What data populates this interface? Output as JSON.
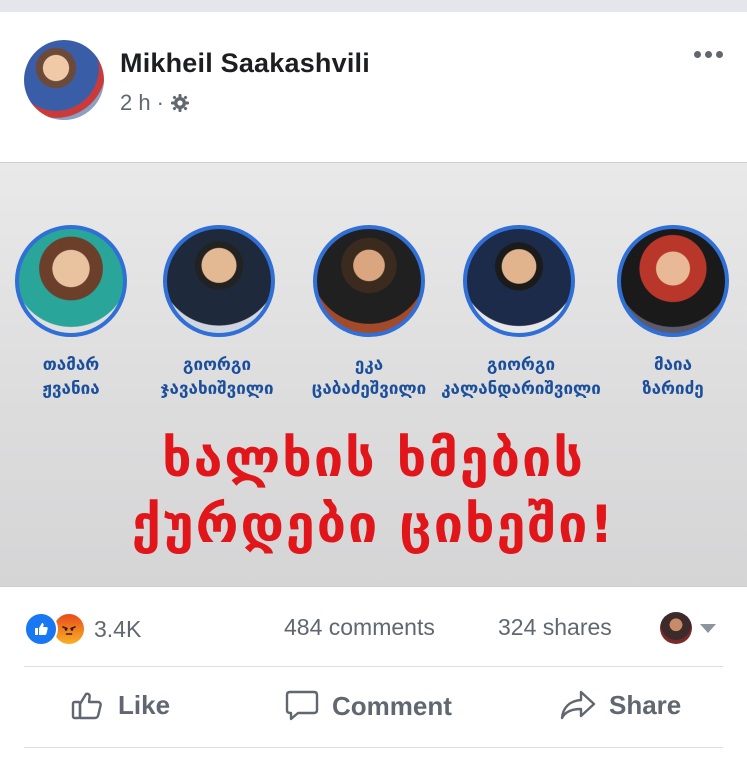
{
  "post": {
    "author": "Mikheil Saakashvili",
    "time": "2 h",
    "separator": "·",
    "privacy_icon": "settings-gear-icon"
  },
  "image": {
    "candidates": [
      {
        "first": "თამარ",
        "last": "ჟვანია"
      },
      {
        "first": "გიორგი",
        "last": "ჯავახიშვილი"
      },
      {
        "first": "ეკა",
        "last": "ცაბაძეშვილი"
      },
      {
        "first": "გიორგი",
        "last": "კალანდარიშვილი"
      },
      {
        "first": "მაია",
        "last": "ზარიძე"
      }
    ],
    "headline_line1": "ხალხის ხმების",
    "headline_line2": "ქურდები ციხეში!",
    "colors": {
      "headline": "#e0161b",
      "names": "#1b4f9c",
      "ring": "#2f6fd6"
    }
  },
  "stats": {
    "reactions": "3.4K",
    "comments": "484 comments",
    "shares": "324 shares"
  },
  "actions": {
    "like": "Like",
    "comment": "Comment",
    "share": "Share"
  },
  "colors": {
    "accent": "#1877f2",
    "muted": "#606770"
  }
}
